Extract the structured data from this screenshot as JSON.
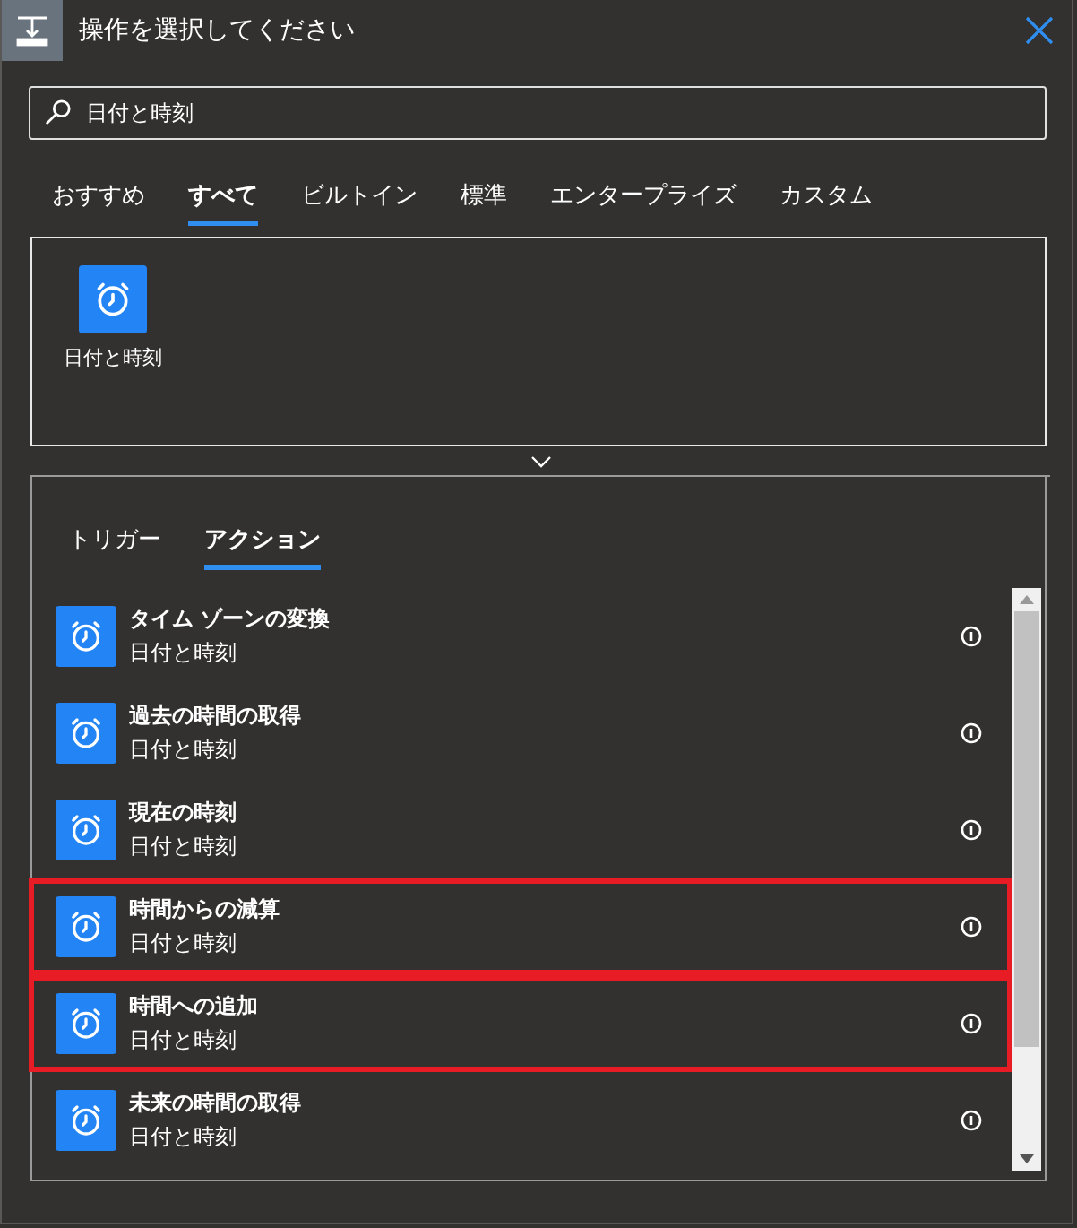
{
  "window": {
    "title": "操作を選択してください"
  },
  "search": {
    "value": "日付と時刻"
  },
  "tabs": [
    {
      "label": "おすすめ",
      "selected": false
    },
    {
      "label": "すべて",
      "selected": true
    },
    {
      "label": "ビルトイン",
      "selected": false
    },
    {
      "label": "標準",
      "selected": false
    },
    {
      "label": "エンタープライズ",
      "selected": false
    },
    {
      "label": "カスタム",
      "selected": false
    }
  ],
  "connectors": [
    {
      "name": "日付と時刻"
    }
  ],
  "subtabs": [
    {
      "label": "トリガー",
      "selected": false
    },
    {
      "label": "アクション",
      "selected": true
    }
  ],
  "actions": [
    {
      "title": "タイム ゾーンの変換",
      "connector": "日付と時刻",
      "highlighted": false
    },
    {
      "title": "過去の時間の取得",
      "connector": "日付と時刻",
      "highlighted": false
    },
    {
      "title": "現在の時刻",
      "connector": "日付と時刻",
      "highlighted": false
    },
    {
      "title": "時間からの減算",
      "connector": "日付と時刻",
      "highlighted": true
    },
    {
      "title": "時間への追加",
      "connector": "日付と時刻",
      "highlighted": true
    },
    {
      "title": "未来の時間の取得",
      "connector": "日付と時刻",
      "highlighted": false
    }
  ]
}
